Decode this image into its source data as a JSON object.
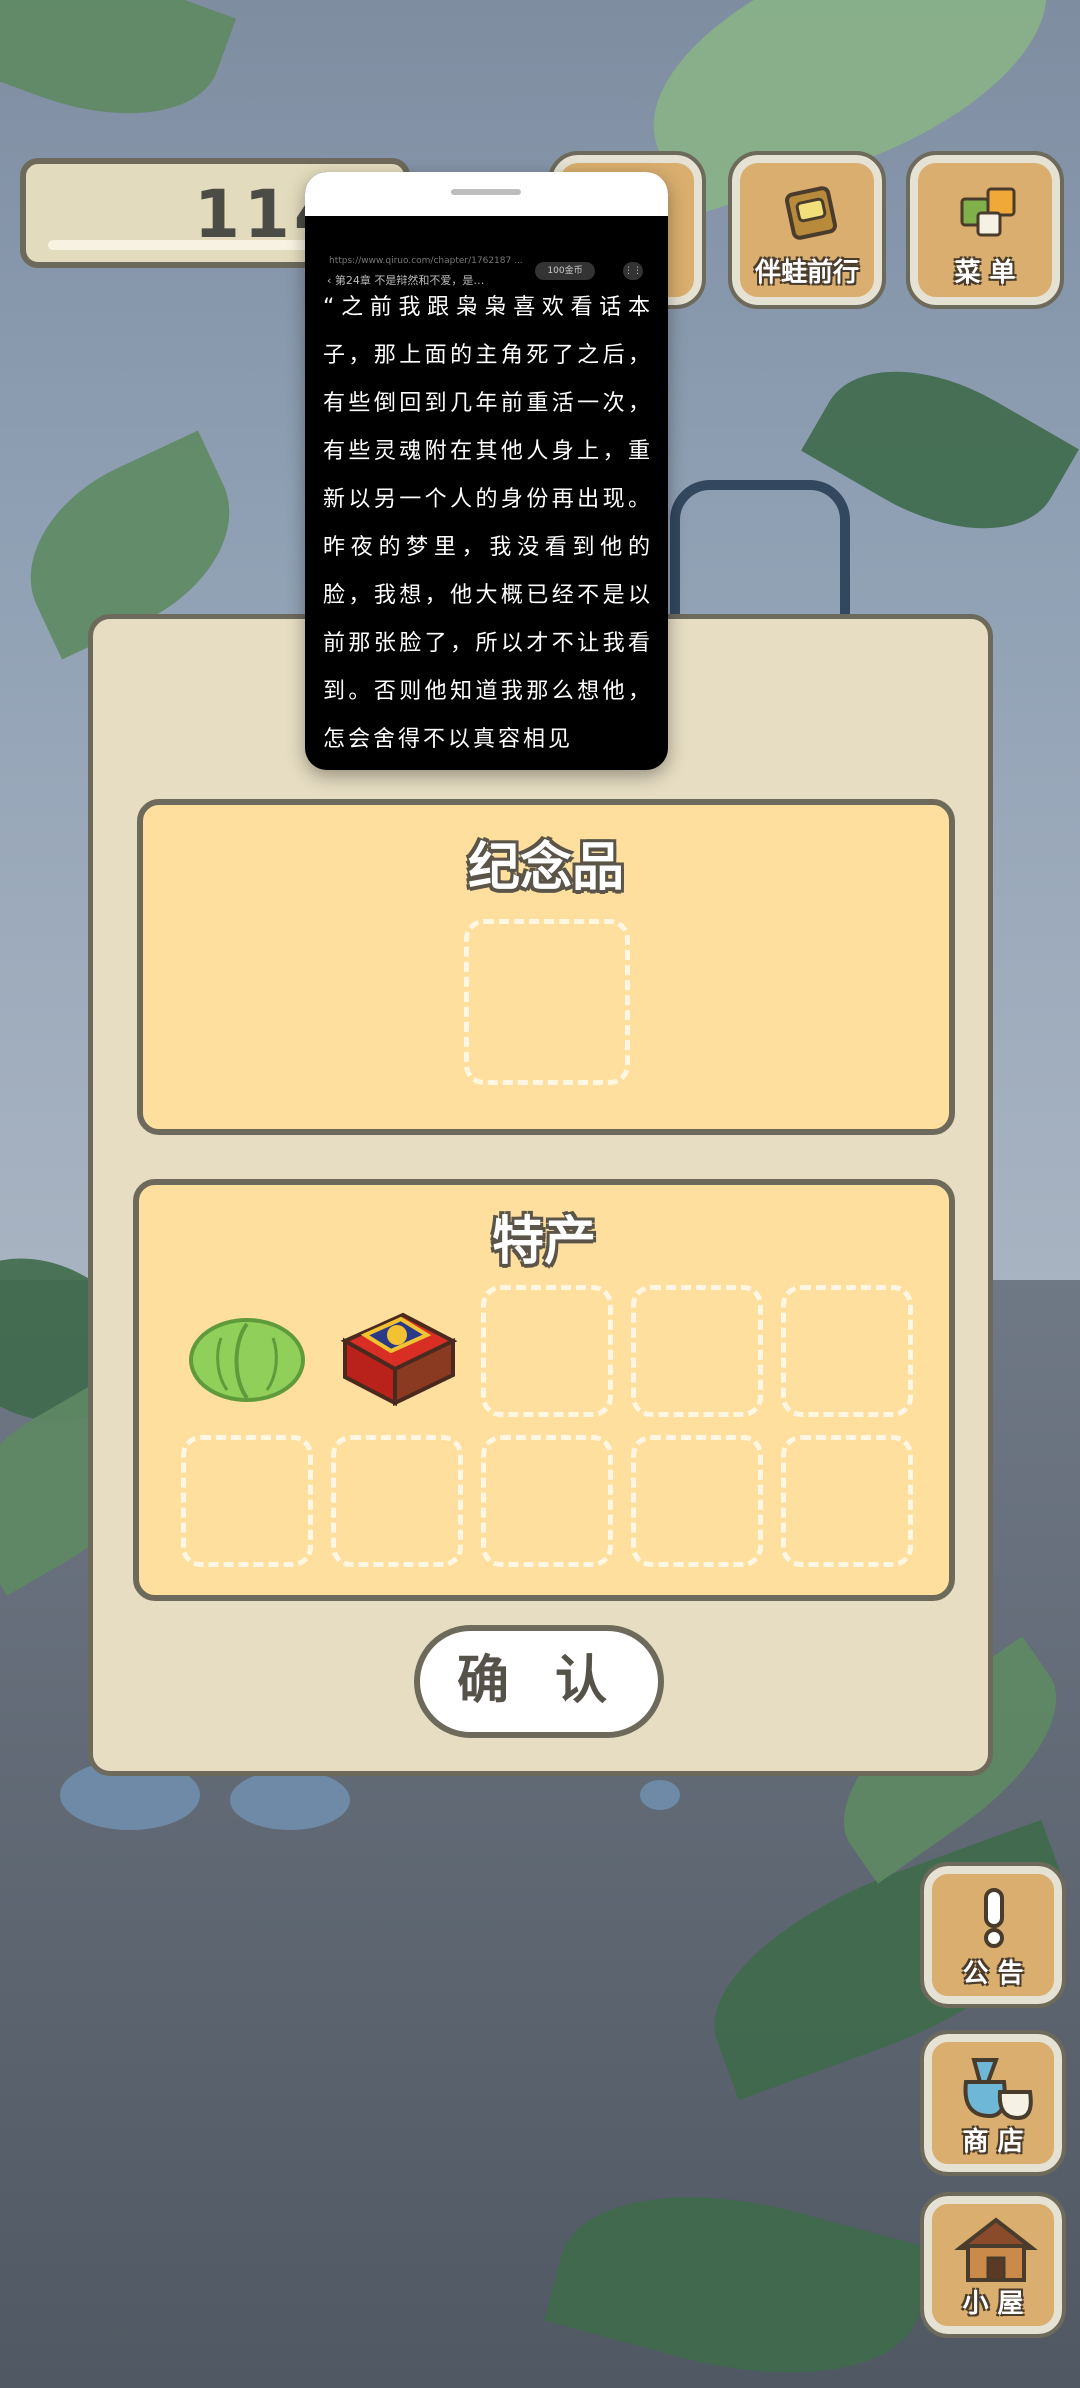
{
  "hud": {
    "counter_value": "114"
  },
  "top_buttons": [
    {
      "label": "",
      "icon": "tool-icon"
    },
    {
      "label": "伴蛙前行",
      "icon": "album-icon"
    },
    {
      "label": "菜 单",
      "icon": "menu-cards-icon"
    }
  ],
  "panel": {
    "souvenir": {
      "title": "纪念品"
    },
    "specialty": {
      "title": "特产"
    },
    "items": [
      {
        "name": "cabbage-icon"
      },
      {
        "name": "gift-box-icon"
      }
    ],
    "confirm_label": "确 认"
  },
  "side_buttons": [
    {
      "label": "公 告",
      "icon": "exclamation-icon"
    },
    {
      "label": "商 店",
      "icon": "bags-icon"
    },
    {
      "label": "小 屋",
      "icon": "house-icon"
    }
  ],
  "reader": {
    "url": "https://www.qiruo.com/chapter/1762187 ...",
    "chapter": "第24章 不是辩然和不爱，是…",
    "coins": "100金币",
    "menu_glyph": "⋮⋮",
    "body": "“之前我跟枭枭喜欢看话本子，那上面的主角死了之后，有些倒回到几年前重活一次，有些灵魂附在其他人身上，重新以另一个人的身份再出现。昨夜的梦里，我没看到他的脸，我想，他大概已经不是以前那张脸了，所以才不让我看到。否则他知道我那么想他，怎会舍得不以真容相见"
  },
  "colors": {
    "panel_bg": "#e6ddc2",
    "box_bg": "#ffdf9e",
    "outline": "#6d6a5c",
    "button_wood": "#d9ae6e"
  }
}
